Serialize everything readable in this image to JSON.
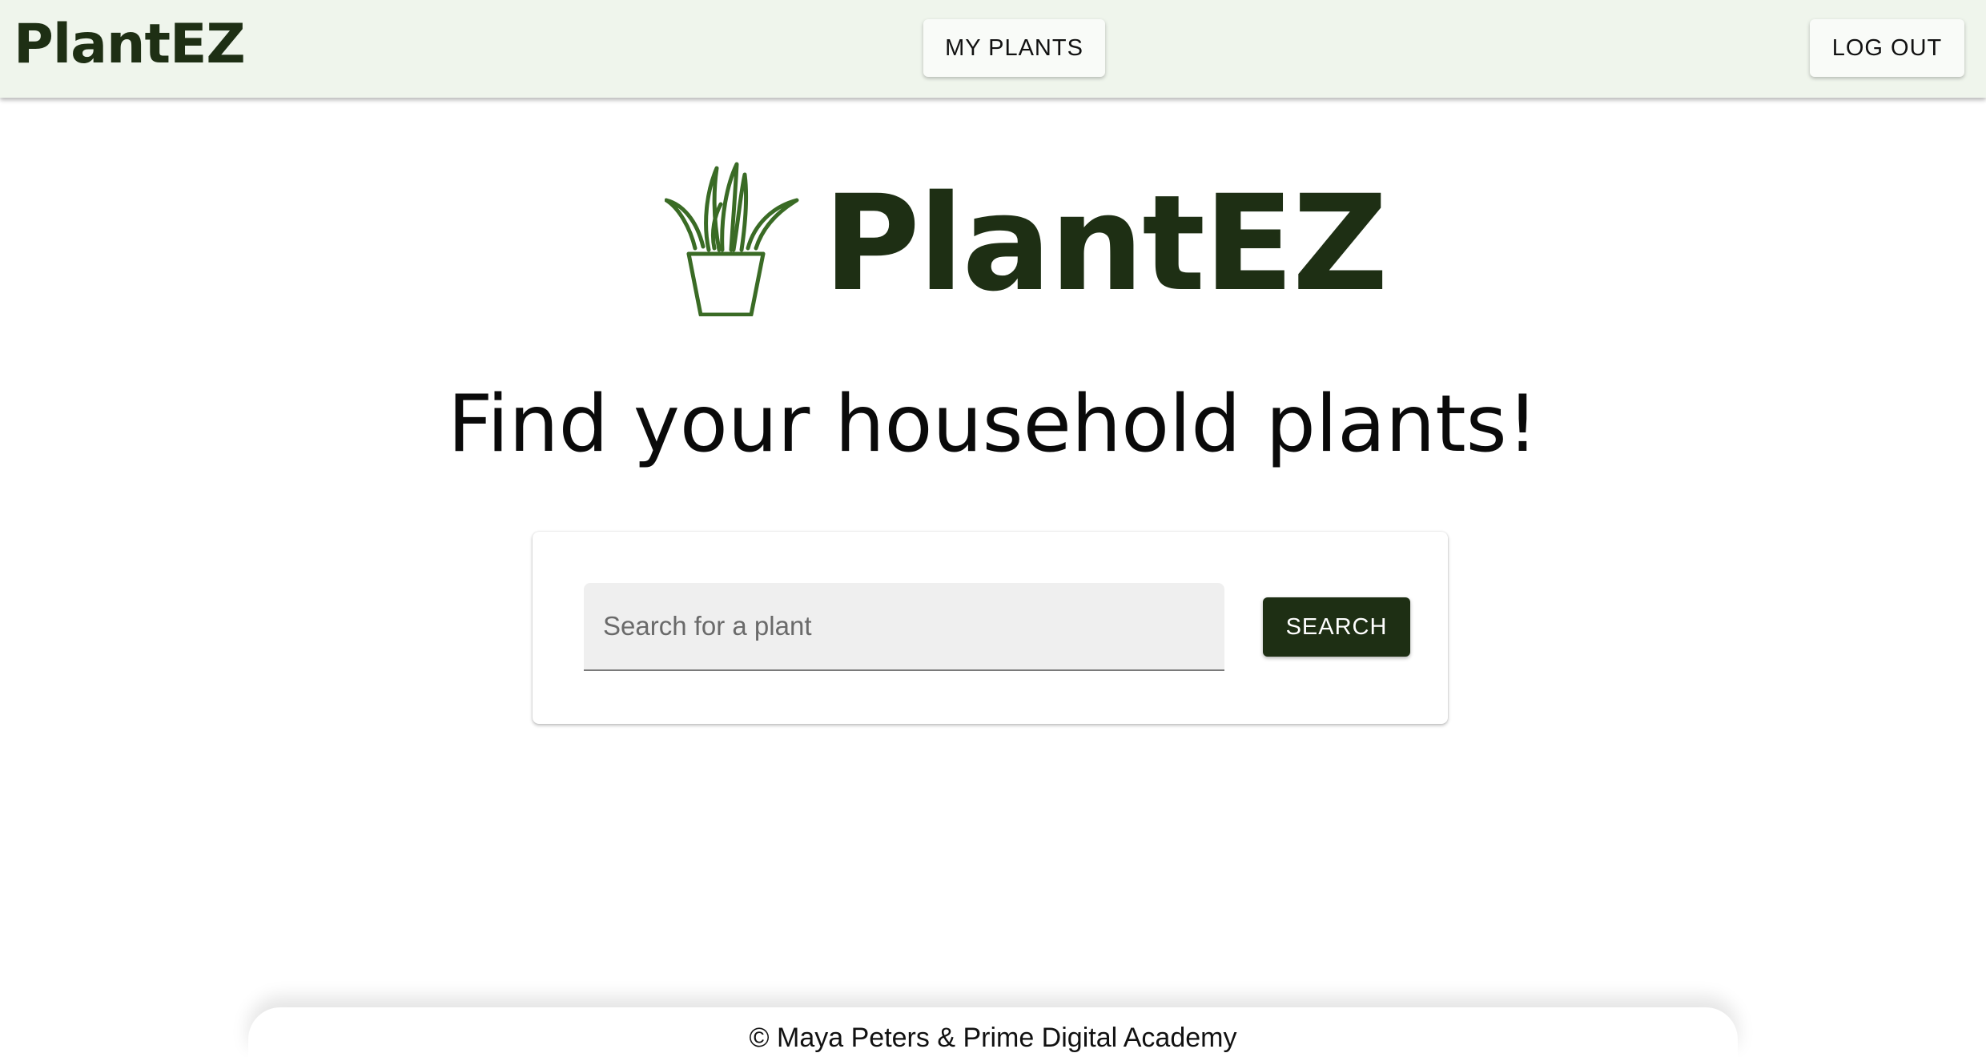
{
  "navbar": {
    "brand": "PlantEZ",
    "my_plants_label": "MY PLANTS",
    "logout_label": "LOG OUT"
  },
  "hero": {
    "brand": "PlantEZ",
    "logo_icon": "potted-plant-icon",
    "headline": "Find your household plants!"
  },
  "search": {
    "placeholder": "Search for a plant",
    "value": "",
    "button_label": "SEARCH"
  },
  "footer": {
    "text": "© Maya Peters & Prime Digital Academy"
  },
  "colors": {
    "brand_dark": "#1e2f14",
    "navbar_bg": "#eff5ec",
    "plant_green": "#3a6b25"
  }
}
